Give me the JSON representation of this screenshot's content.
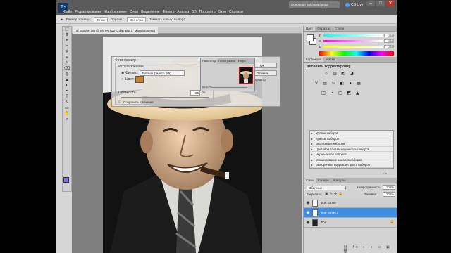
{
  "app": {
    "logo_text": "Ps",
    "menu": [
      "Файл",
      "Редактирование",
      "Изображение",
      "Слои",
      "Выделение",
      "Фильтр",
      "Анализ",
      "3D",
      "Просмотр",
      "Окно",
      "Справка"
    ],
    "workspace_label": "Основная рабочая среда",
    "cs_live": "CS Live",
    "window_buttons": [
      "–",
      "□",
      "✕"
    ]
  },
  "options_bar": {
    "size_label": "Размер образца:",
    "size_value": "Точка",
    "sample_label": "Образец:",
    "sample_value": "Все слои",
    "show_ring": "Показать кольцо выбора"
  },
  "tools": [
    "⬚",
    "✥",
    "⌖",
    "✂",
    "⚲",
    "⊕",
    "✎",
    "⌫",
    "◍",
    "▲",
    "◐",
    "✒",
    "T",
    "↖",
    "▭",
    "✋",
    "⌕"
  ],
  "document": {
    "tab": "al kapone.jpg @ 66,7% (Фото фильтр 1, Маска слоя/8)"
  },
  "filter_dialog": {
    "title": "Фото фильтр",
    "group_label": "Использование",
    "filter_label": "Фильтр:",
    "filter_value": "Теплый фильтр (85)",
    "color_label": "Цвет:",
    "density_label": "Плотность:",
    "density_value": "25",
    "density_unit": "%",
    "preserve_label": "Сохранить свечение",
    "ok_label": "ОК",
    "cancel_label": "Отмена",
    "preview_label": "Просмотр",
    "accent_color": "#c9822a"
  },
  "navigator": {
    "tabs": [
      "Навигатор",
      "Гистограмма",
      "Инфо"
    ],
    "zoom": "66.67%"
  },
  "color_panel": {
    "tabs": [
      "Цвет",
      "Образцы",
      "Стили"
    ],
    "channels": [
      {
        "label": "R",
        "value": "255"
      },
      {
        "label": "G",
        "value": "255"
      },
      {
        "label": "B",
        "value": "255"
      }
    ]
  },
  "adjustments": {
    "tabs": [
      "Коррекция",
      "Маски"
    ],
    "heading": "Добавить корректировку",
    "icon_row1": [
      "☼",
      "▥",
      "◩",
      "◪"
    ],
    "icon_row2": [
      "V",
      "▤",
      "⚖",
      "◧",
      "◑",
      "▦"
    ],
    "icon_row3": [
      "◫",
      "◔",
      "◰",
      "◩",
      "◮"
    ],
    "presets": [
      "Уровни наборов",
      "Кривые наборов",
      "Экспозиция наборов",
      "Цветовой тон/Насыщенность наборов",
      "Черно-белое наборов",
      "Микширование каналов наборов",
      "Выборочная коррекция цвета наборов"
    ],
    "footer": "▫ ▪"
  },
  "layers": {
    "tabs": [
      "Слои",
      "Каналы",
      "Контуры"
    ],
    "blend_mode": "Обычные",
    "opacity_label": "Непрозрачность:",
    "opacity_value": "100%",
    "lock_label": "Закрепить:",
    "lock_icons": "▣✎✥🔒",
    "fill_label": "Заливка:",
    "fill_value": "100%",
    "items": [
      {
        "name": "Фон копия",
        "selected": false,
        "photo": false,
        "lock": ""
      },
      {
        "name": "Фон копия 2",
        "selected": true,
        "photo": false,
        "lock": ""
      },
      {
        "name": "Фон",
        "selected": false,
        "photo": true,
        "lock": "🔒"
      }
    ],
    "footer": "⛓ fx ◐ ◑ ▭ ▣ 🗑"
  }
}
